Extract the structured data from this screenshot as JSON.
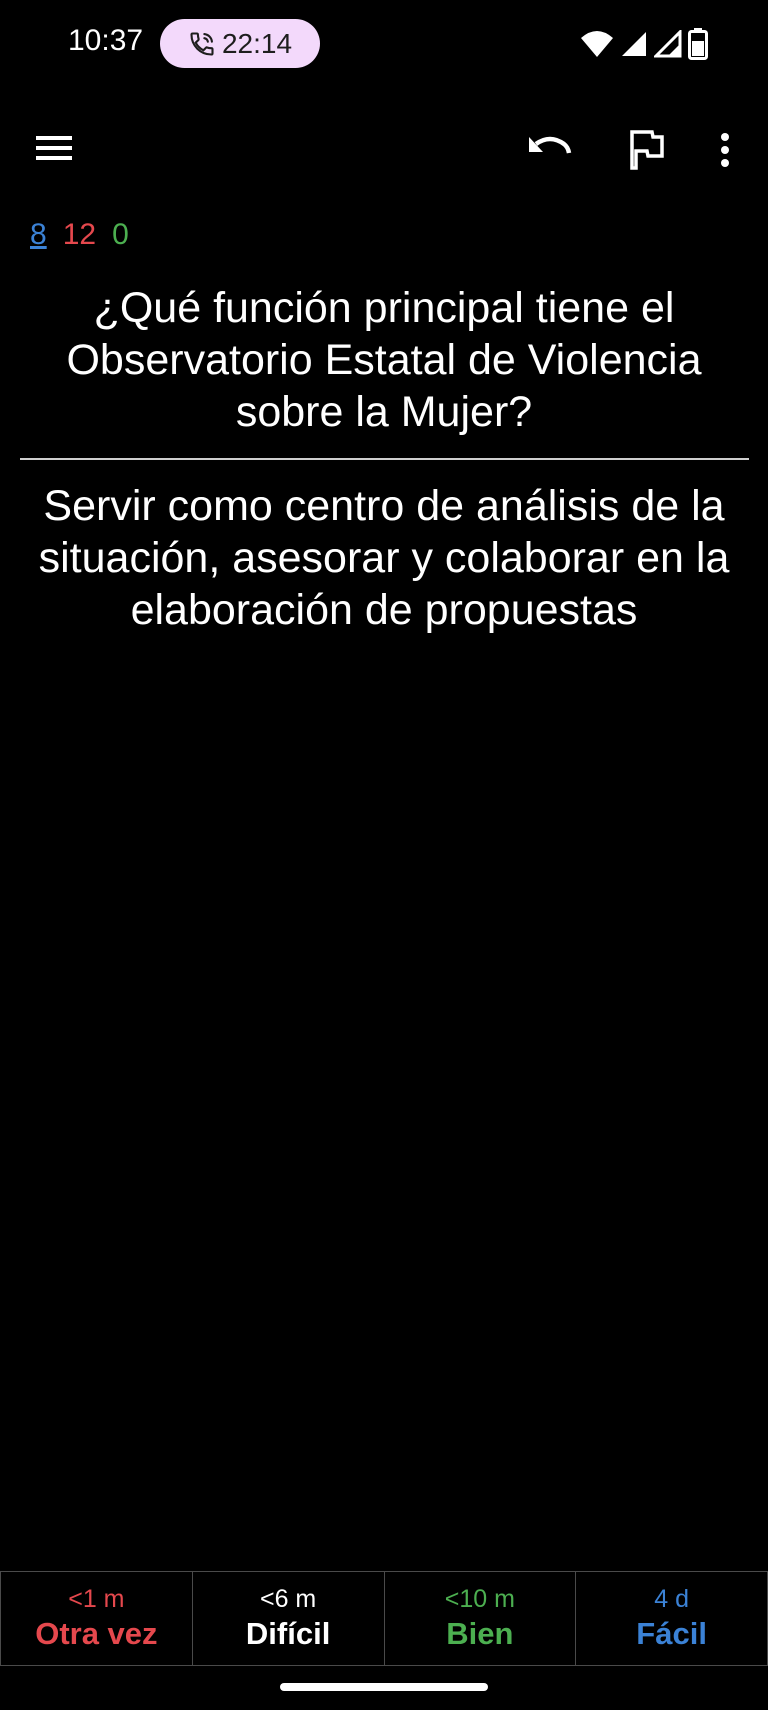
{
  "status_bar": {
    "time": "10:37",
    "call_timer": "22:14",
    "icons": [
      "phone-call-icon",
      "wifi-icon",
      "signal-icon",
      "signal-icon",
      "battery-icon"
    ]
  },
  "toolbar": {
    "icons": [
      "menu-icon",
      "undo-icon",
      "flag-icon",
      "more-vert-icon"
    ]
  },
  "counts": {
    "new": "8",
    "learning": "12",
    "review": "0"
  },
  "card": {
    "question": "¿Qué función principal tiene el Observatorio Estatal de Violencia sobre la Mujer?",
    "answer": "Servir como centro de análisis de la situación, asesorar y colaborar en la elaboración de propuestas"
  },
  "answer_buttons": [
    {
      "time": "<1 m",
      "label": "Otra vez"
    },
    {
      "time": "<6 m",
      "label": "Difícil"
    },
    {
      "time": "<10 m",
      "label": "Bien"
    },
    {
      "time": "4 d",
      "label": "Fácil"
    }
  ],
  "colors": {
    "again": "#e5484d",
    "hard": "#ffffff",
    "good": "#4caf50",
    "easy": "#3b82d6",
    "call_pill": "#f3d9fb",
    "background": "#000000"
  }
}
